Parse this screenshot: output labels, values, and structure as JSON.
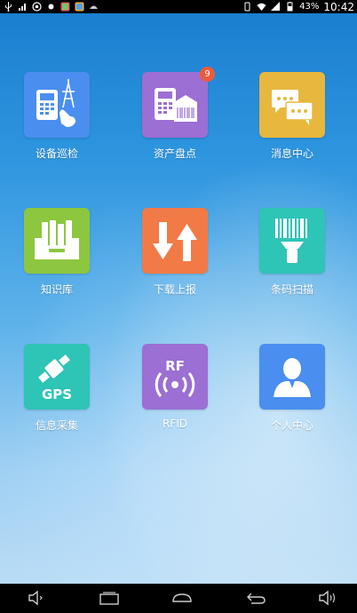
{
  "status_bar": {
    "battery_percent": "43%",
    "time": "10:42",
    "left_icons": [
      "usb-icon",
      "signal-icon",
      "app-icon",
      "app-icon",
      "app-icon",
      "app-icon"
    ],
    "right_icons": [
      "vibrate-icon",
      "wifi-icon",
      "signal-icon",
      "battery-icon"
    ]
  },
  "tiles": [
    {
      "label": "设备巡检",
      "color": "#4a8ef0",
      "icon": "device-inspection-icon"
    },
    {
      "label": "资产盘点",
      "color": "#9b6fd3",
      "icon": "asset-inventory-icon",
      "badge": "9"
    },
    {
      "label": "消息中心",
      "color": "#e7b83d",
      "icon": "message-center-icon"
    },
    {
      "label": "知识库",
      "color": "#8dc63f",
      "icon": "knowledge-base-icon"
    },
    {
      "label": "下载上报",
      "color": "#f27a47",
      "icon": "download-upload-icon"
    },
    {
      "label": "条码扫描",
      "color": "#2ec4b6",
      "icon": "barcode-scan-icon"
    },
    {
      "label": "信息采集",
      "color": "#2ec4b6",
      "icon": "gps-collect-icon",
      "icon_text": "GPS"
    },
    {
      "label": "RFID",
      "color": "#9b6fd3",
      "icon": "rfid-icon",
      "icon_text": "RF"
    },
    {
      "label": "个人中心",
      "color": "#4a8ef0",
      "icon": "profile-icon"
    }
  ],
  "nav_bar": [
    "volume-down-icon",
    "recent-apps-icon",
    "home-icon",
    "back-icon",
    "volume-up-icon"
  ]
}
